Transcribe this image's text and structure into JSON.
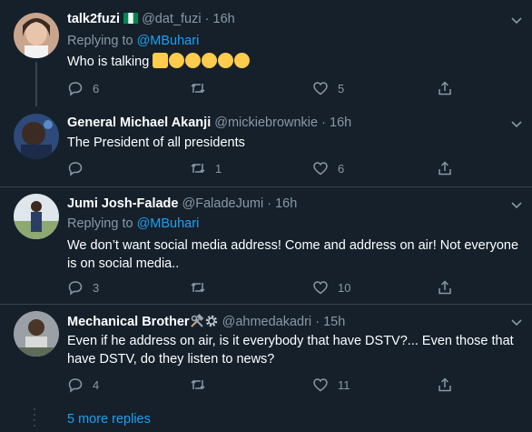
{
  "tweets": [
    {
      "name": "talk2fuzi",
      "handle": "@dat_fuzi",
      "time": "16h",
      "replying_label": "Replying to",
      "replying_to": "@MBuhari",
      "text": "Who is talking",
      "emojis": [
        "thumbs-up",
        "frowning-face",
        "frowning-face",
        "rolling-laughing-face",
        "rolling-laughing-face",
        "rolling-laughing-face"
      ],
      "flag_icon": "nigeria-flag-icon",
      "replies": "6",
      "retweets": "",
      "likes": "5"
    },
    {
      "name": "General Michael Akanji",
      "handle": "@mickiebrownkie",
      "time": "16h",
      "text": "The President of all presidents",
      "replies": "",
      "retweets": "1",
      "likes": "6"
    },
    {
      "name": "Jumi Josh-Falade",
      "handle": "@FaladeJumi",
      "time": "16h",
      "replying_label": "Replying to",
      "replying_to": "@MBuhari",
      "text": "We don’t want social media address! Come and address on air! Not everyone is on social media..",
      "replies": "3",
      "retweets": "",
      "likes": "10"
    },
    {
      "name": "Mechanical Brother",
      "name_icons": [
        "hammer-wrench-icon",
        "gear-icon"
      ],
      "handle": "@ahmedakadri",
      "time": "15h",
      "text": "Even if he address on air, is it everybody that have DSTV?... Even those that have DSTV, do they listen to news?",
      "replies": "4",
      "retweets": "",
      "likes": "11"
    }
  ],
  "separator": "·",
  "more_replies": "5 more replies",
  "colors": {
    "background": "#15202b",
    "accent": "#1da1f2",
    "muted": "#8899a6",
    "border": "#38444d"
  }
}
